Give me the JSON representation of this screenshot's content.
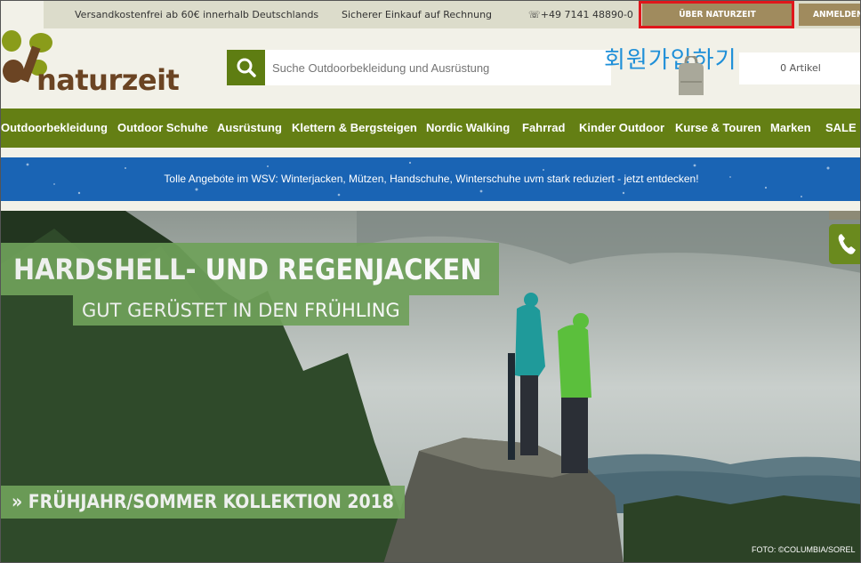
{
  "topbar": {
    "shipping": "Versandkostenfrei ab 60€ innerhalb Deutschlands",
    "secure": "Sicherer Einkauf auf Rechnung",
    "phone": "☏+49 7141 48890-0",
    "about_label": "ÜBER NATURZEIT",
    "login_label": "ANMELDEN"
  },
  "header": {
    "logo_text": "naturzeit",
    "search_placeholder": "Suche Outdoorbekleidung und Ausrüstung",
    "overlay_korean": "회원가입하기",
    "cart_label": "0 Artikel"
  },
  "nav": {
    "items": [
      "Outdoorbekleidung",
      "Outdoor Schuhe",
      "Ausrüstung",
      "Klettern & Bergsteigen",
      "Nordic Walking",
      "Fahrrad",
      "Kinder Outdoor",
      "Kurse & Touren",
      "Marken",
      "SALE"
    ]
  },
  "promo": {
    "text": "Tolle Angebote im WSV: Winterjacken, Mützen, Handschuhe, Winterschuhe uvm stark reduziert - jetzt entdecken!"
  },
  "hero": {
    "title": "HARDSHELL- UND REGENJACKEN",
    "subtitle": "GUT GERÜSTET IN DEN FRÜHLING",
    "cta": "» FRÜHJAHR/SOMMER KOLLEKTION 2018",
    "credit": "FOTO: ©COLUMBIA/SOREL"
  },
  "colors": {
    "nav_green": "#647f14",
    "accent_brown": "#a08b5e",
    "highlight_red": "#e0161b",
    "promo_blue": "#1a64b4",
    "hero_label_green": "#6fa15a"
  }
}
